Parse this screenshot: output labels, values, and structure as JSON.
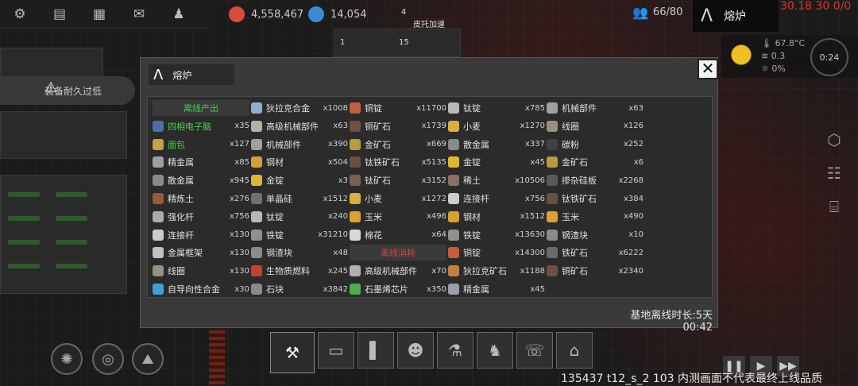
{
  "topbar": {
    "buttons": [
      "gear-icon",
      "chat-icon",
      "keyboard-icon",
      "mail-icon",
      "user-icon"
    ],
    "resource1": "4,558,467",
    "resource2": "14,054",
    "population": "66/80",
    "location": "熔炉",
    "timer": "30.18 30 0/0"
  },
  "map_labels": {
    "label1": "皮托加速",
    "num4": "4",
    "num1": "1",
    "num15": "15"
  },
  "weather": {
    "temp": "67.8°C",
    "wind": "0.3",
    "sun": "0%",
    "clock": "0:24"
  },
  "warning": {
    "text": "装备耐久过低"
  },
  "modal": {
    "title": "熔炉",
    "footer": "基地离线时长:5天 00:42",
    "col1": [
      {
        "name": "离线产出",
        "qty": "",
        "header": true,
        "color": "#3bd14a"
      },
      {
        "name": "四相电子脑",
        "qty": "x35",
        "color": "#4bcf4b",
        "icon": "#4b6fa8"
      },
      {
        "name": "面包",
        "qty": "x127",
        "color": "#4bcf4b",
        "icon": "#c8a040"
      },
      {
        "name": "精金属",
        "qty": "x85",
        "icon": "#9aa0a8"
      },
      {
        "name": "散金属",
        "qty": "x945",
        "icon": "#8a8a8a"
      },
      {
        "name": "精炼土",
        "qty": "x276",
        "icon": "#9a5a3a"
      },
      {
        "name": "强化杆",
        "qty": "x756",
        "icon": "#aaaaaa"
      },
      {
        "name": "连接杆",
        "qty": "x130",
        "icon": "#cccccc"
      },
      {
        "name": "金属框架",
        "qty": "x130",
        "icon": "#c0c0c0"
      },
      {
        "name": "线圈",
        "qty": "x130",
        "icon": "#9a8f80"
      },
      {
        "name": "自导向性合金",
        "qty": "x30",
        "icon": "#3fa0d8"
      }
    ],
    "col2": [
      {
        "name": "狄拉克合金",
        "qty": "x1008",
        "icon": "#8ab0d8"
      },
      {
        "name": "高级机械部件",
        "qty": "x63",
        "icon": "#b0b0b0"
      },
      {
        "name": "机械部件",
        "qty": "x390",
        "icon": "#a0a0a0"
      },
      {
        "name": "钢材",
        "qty": "x504",
        "icon": "#d8a030"
      },
      {
        "name": "金锭",
        "qty": "x3",
        "icon": "#e0b830"
      },
      {
        "name": "单晶硅",
        "qty": "x1512",
        "icon": "#707070"
      },
      {
        "name": "钛锭",
        "qty": "x240",
        "icon": "#b8b8b8"
      },
      {
        "name": "铁锭",
        "qty": "x31210",
        "icon": "#909090"
      },
      {
        "name": "钢渣块",
        "qty": "x48",
        "icon": "#8a8a90"
      },
      {
        "name": "生物质燃料",
        "qty": "x245",
        "icon": "#c84030"
      },
      {
        "name": "石块",
        "qty": "x3842",
        "icon": "#8a8a8a"
      }
    ],
    "col3": [
      {
        "name": "铜锭",
        "qty": "x11700",
        "icon": "#c0603a"
      },
      {
        "name": "铜矿石",
        "qty": "x1739",
        "icon": "#705040"
      },
      {
        "name": "金矿石",
        "qty": "x669",
        "icon": "#b89a40"
      },
      {
        "name": "钛铁矿石",
        "qty": "x5135",
        "icon": "#6a5040"
      },
      {
        "name": "钛矿石",
        "qty": "x3152",
        "icon": "#7a6050"
      },
      {
        "name": "小麦",
        "qty": "x1272",
        "icon": "#d8b040"
      },
      {
        "name": "玉米",
        "qty": "x496",
        "icon": "#e0a030"
      },
      {
        "name": "棉花",
        "qty": "x64",
        "icon": "#d8d8d8"
      },
      {
        "name": "离线消耗",
        "qty": "",
        "header": true,
        "color": "#e0403a"
      },
      {
        "name": "高级机械部件",
        "qty": "x70",
        "icon": "#b0b0b0"
      },
      {
        "name": "石墨烯芯片",
        "qty": "x350",
        "icon": "#4ab04a"
      }
    ],
    "col4": [
      {
        "name": "钛锭",
        "qty": "x785",
        "icon": "#b8b8b8"
      },
      {
        "name": "小麦",
        "qty": "x1270",
        "icon": "#d8b040"
      },
      {
        "name": "散金属",
        "qty": "x337",
        "icon": "#8a8a8a"
      },
      {
        "name": "金锭",
        "qty": "x45",
        "icon": "#e0b830"
      },
      {
        "name": "稀土",
        "qty": "x10506",
        "icon": "#8a7060"
      },
      {
        "name": "连接杆",
        "qty": "x756",
        "icon": "#cccccc"
      },
      {
        "name": "钢材",
        "qty": "x1512",
        "icon": "#d8a030"
      },
      {
        "name": "铁锭",
        "qty": "x13630",
        "icon": "#909090"
      },
      {
        "name": "铜锭",
        "qty": "x14300",
        "icon": "#c0603a"
      },
      {
        "name": "狄拉克矿石",
        "qty": "x1188",
        "icon": "#c08040"
      },
      {
        "name": "精金属",
        "qty": "x45",
        "icon": "#9aa0a8"
      }
    ],
    "col5": [
      {
        "name": "机械部件",
        "qty": "x63",
        "icon": "#a0a0a0"
      },
      {
        "name": "线圈",
        "qty": "x126",
        "icon": "#9a8f80"
      },
      {
        "name": "碳粉",
        "qty": "x252",
        "icon": "#404040"
      },
      {
        "name": "金矿石",
        "qty": "x6",
        "icon": "#b89a40"
      },
      {
        "name": "掺杂硅板",
        "qty": "x2268",
        "icon": "#5a5a5a"
      },
      {
        "name": "钛铁矿石",
        "qty": "x384",
        "icon": "#6a5040"
      },
      {
        "name": "玉米",
        "qty": "x490",
        "icon": "#e0a030"
      },
      {
        "name": "钢渣块",
        "qty": "x10",
        "icon": "#8a8a90"
      },
      {
        "name": "铁矿石",
        "qty": "x6222",
        "icon": "#6a6a70"
      },
      {
        "name": "铜矿石",
        "qty": "x2340",
        "icon": "#705040"
      }
    ]
  },
  "bottom": {
    "left_buttons": [
      "galaxy-icon",
      "planet-icon",
      "mountain-icon"
    ],
    "toolbar": [
      "tools-icon",
      "folder-icon",
      "waveform-icon",
      "people-icon",
      "flask-icon",
      "cat-icon",
      "chat-icon",
      "bank-icon"
    ],
    "version": "135437 t12_s_2 103  内测画面不代表最终上线品质"
  }
}
